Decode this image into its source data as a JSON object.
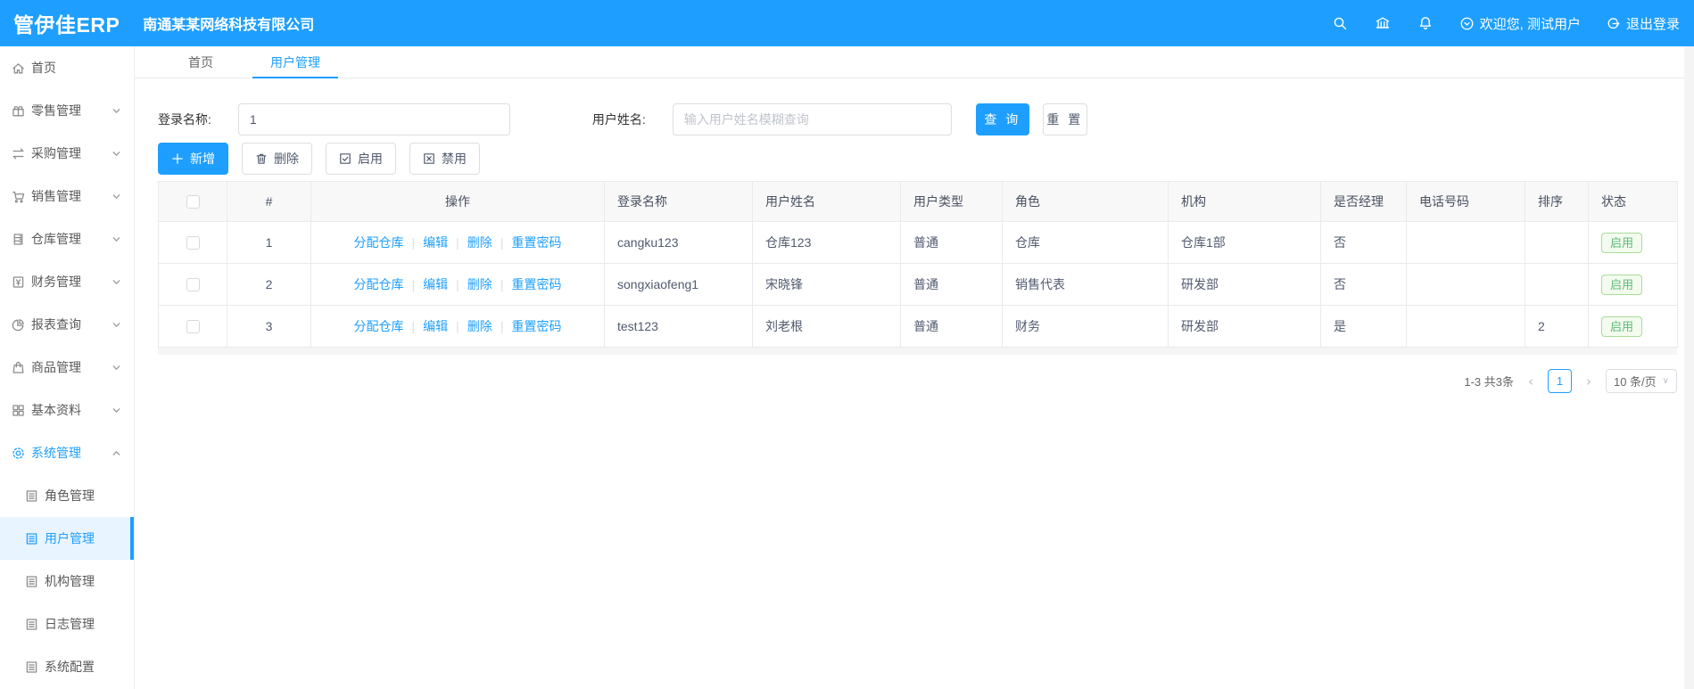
{
  "colors": {
    "primary": "#1e9fff",
    "success": "#5fb878",
    "success_bg": "#f2fbee",
    "header_bg": "#1e9fff",
    "active_menu_bg": "#e8f4ff"
  },
  "header": {
    "logo": "管伊佳ERP",
    "company": "南通某某网络科技有限公司",
    "welcome": "欢迎您, 测试用户",
    "logout": "退出登录",
    "icons": [
      "search-icon",
      "bank-icon",
      "bell-icon"
    ]
  },
  "sidebar": {
    "items": [
      {
        "label": "首页",
        "icon": "home-icon",
        "chevron": ""
      },
      {
        "label": "零售管理",
        "icon": "gift-icon",
        "chevron": "down"
      },
      {
        "label": "采购管理",
        "icon": "swap-icon",
        "chevron": "down"
      },
      {
        "label": "销售管理",
        "icon": "cart-icon",
        "chevron": "down"
      },
      {
        "label": "仓库管理",
        "icon": "warehouse-icon",
        "chevron": "down"
      },
      {
        "label": "财务管理",
        "icon": "finance-icon",
        "chevron": "down"
      },
      {
        "label": "报表查询",
        "icon": "piechart-icon",
        "chevron": "down"
      },
      {
        "label": "商品管理",
        "icon": "goods-icon",
        "chevron": "down"
      },
      {
        "label": "基本资料",
        "icon": "grid-icon",
        "chevron": "down"
      },
      {
        "label": "系统管理",
        "icon": "gear-icon",
        "chevron": "up",
        "active": true
      }
    ],
    "submenu": [
      {
        "label": "角色管理",
        "icon": "doc-icon"
      },
      {
        "label": "用户管理",
        "icon": "doc-icon",
        "active": true
      },
      {
        "label": "机构管理",
        "icon": "doc-icon"
      },
      {
        "label": "日志管理",
        "icon": "doc-icon"
      },
      {
        "label": "系统配置",
        "icon": "doc-icon"
      }
    ]
  },
  "tabs": [
    {
      "label": "首页"
    },
    {
      "label": "用户管理",
      "active": true
    }
  ],
  "search": {
    "login_label": "登录名称:",
    "login_value": "1",
    "name_label": "用户姓名:",
    "name_placeholder": "输入用户姓名模糊查询",
    "query_btn": "查 询",
    "reset_btn": "重 置"
  },
  "toolbar": {
    "buttons": [
      {
        "label": "新增",
        "icon": "plus-icon",
        "name": "add-button",
        "primary": true
      },
      {
        "label": "删除",
        "icon": "trash-icon",
        "name": "delete-button"
      },
      {
        "label": "启用",
        "icon": "check-square-icon",
        "name": "enable-button"
      },
      {
        "label": "禁用",
        "icon": "x-square-icon",
        "name": "disable-button"
      }
    ]
  },
  "table": {
    "headers": [
      "#",
      "操作",
      "登录名称",
      "用户姓名",
      "用户类型",
      "角色",
      "机构",
      "是否经理",
      "电话号码",
      "排序",
      "状态"
    ],
    "op_links": [
      "分配仓库",
      "编辑",
      "删除",
      "重置密码"
    ],
    "rows": [
      {
        "index": "1",
        "login": "cangku123",
        "name": "仓库123",
        "type": "普通",
        "role": "仓库",
        "org": "仓库1部",
        "manager": "否",
        "phone": "",
        "sort": "",
        "status": "启用"
      },
      {
        "index": "2",
        "login": "songxiaofeng1",
        "name": "宋晓锋",
        "type": "普通",
        "role": "销售代表",
        "org": "研发部",
        "manager": "否",
        "phone": "",
        "sort": "",
        "status": "启用"
      },
      {
        "index": "3",
        "login": "test123",
        "name": "刘老根",
        "type": "普通",
        "role": "财务",
        "org": "研发部",
        "manager": "是",
        "phone": "",
        "sort": "2",
        "status": "启用"
      }
    ]
  },
  "pagination": {
    "total": "1-3 共3条",
    "prev": "‹",
    "page": "1",
    "next": "›",
    "page_size": "10 条/页"
  }
}
